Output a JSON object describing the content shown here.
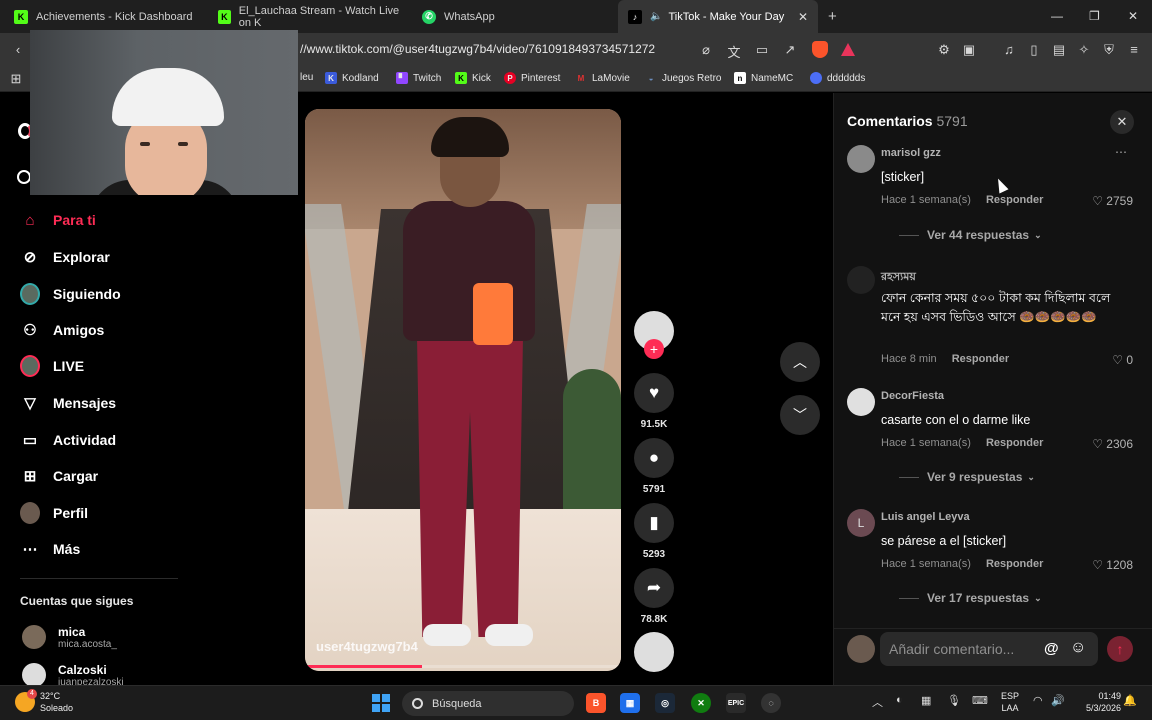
{
  "browser": {
    "tabs": [
      {
        "label": "Achievements - Kick Dashboard",
        "icon": "kick-icon"
      },
      {
        "label": "El_Lauchaa Stream - Watch Live on K",
        "icon": "kick-icon"
      },
      {
        "label": "WhatsApp",
        "icon": "whatsapp-icon"
      },
      {
        "label": "TikTok - Make Your Day",
        "icon": "tiktok-icon",
        "active": true
      }
    ],
    "url": "//www.tiktok.com/@user4tugzwg7b4/video/7610918493734571272",
    "bookmarks": [
      {
        "label": "leu"
      },
      {
        "label": "Kodland",
        "color": "#3b5bdb"
      },
      {
        "label": "Twitch",
        "color": "#9146ff"
      },
      {
        "label": "Kick",
        "color": "#53fc18"
      },
      {
        "label": "Pinterest",
        "color": "#e60023"
      },
      {
        "label": "LaMovie",
        "color": "#e03131"
      },
      {
        "label": "Juegos Retro",
        "color": "#6c8ebf"
      },
      {
        "label": "NameMC",
        "color": "#ffffff"
      },
      {
        "label": "dddddds",
        "color": "#4c6ef5"
      }
    ]
  },
  "sidebar": {
    "nav": [
      {
        "label": "Para ti",
        "icon": "home-icon",
        "active": true
      },
      {
        "label": "Explorar",
        "icon": "compass-icon"
      },
      {
        "label": "Siguiendo",
        "icon": "following-avatar-icon"
      },
      {
        "label": "Amigos",
        "icon": "friends-icon"
      },
      {
        "label": "LIVE",
        "icon": "live-avatar-icon"
      },
      {
        "label": "Mensajes",
        "icon": "send-icon"
      },
      {
        "label": "Actividad",
        "icon": "activity-icon"
      },
      {
        "label": "Cargar",
        "icon": "upload-icon"
      },
      {
        "label": "Perfil",
        "icon": "profile-avatar-icon"
      },
      {
        "label": "Más",
        "icon": "more-dots-icon"
      }
    ],
    "following_title": "Cuentas que sigues",
    "following": [
      {
        "name": "mica",
        "handle": "mica.acosta_"
      },
      {
        "name": "Calzoski",
        "handle": "juanpezalzoski"
      }
    ]
  },
  "video": {
    "username": "user4tugzwg7b4",
    "progress": 0.37
  },
  "actions": {
    "likes": "91.5K",
    "comments": "5791",
    "saves": "5293",
    "shares": "78.8K"
  },
  "comments_panel": {
    "title": "Comentarios",
    "count": "5791",
    "reply_label": "Responder",
    "input_placeholder": "Añadir comentario...",
    "items": [
      {
        "user": "marisol gzz",
        "text": "[sticker]",
        "time": "Hace 1 semana(s)",
        "likes": "2759",
        "replies": "Ver 44 respuestas"
      },
      {
        "user": "রহস্যময়",
        "text": "ফোন কেনার সময় ৫০০ টাকা কম দিছিলাম বলে মনে হয় এসব ভিডিও আসে 🍩🍩🍩🍩🍩",
        "time": "Hace 8 min",
        "likes": "0",
        "replies": ""
      },
      {
        "user": "DecorFiesta",
        "text": "casarte con el o darme like",
        "time": "Hace 1 semana(s)",
        "likes": "2306",
        "replies": "Ver 9 respuestas"
      },
      {
        "user": "Luis angel Leyva",
        "avatar_letter": "L",
        "text": "se párese a el [sticker]",
        "time": "Hace 1 semana(s)",
        "likes": "1208",
        "replies": "Ver 17 respuestas"
      }
    ]
  },
  "taskbar": {
    "temperature": "32°C",
    "weather": "Soleado",
    "search": "Búsqueda",
    "lang_top": "ESP",
    "lang_bottom": "LAA",
    "time": "01:49",
    "date": "5/3/2026",
    "weather_badge": "4"
  }
}
